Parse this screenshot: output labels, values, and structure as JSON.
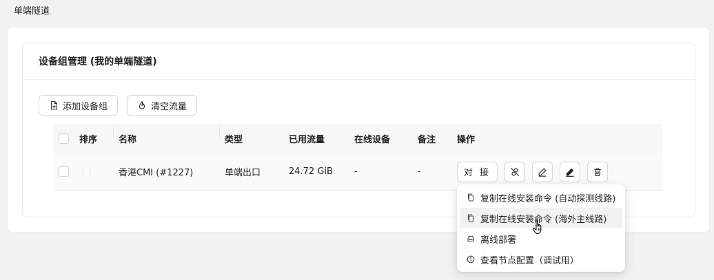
{
  "page": {
    "title": "单端隧道"
  },
  "card": {
    "title": "设备组管理 (我的单端隧道)"
  },
  "toolbar": {
    "add_label": "添加设备组",
    "clear_label": "清空流量"
  },
  "table": {
    "headers": {
      "sort": "排序",
      "name": "名称",
      "type": "类型",
      "used": "已用流量",
      "online": "在线设备",
      "note": "备注",
      "ops": "操作"
    },
    "rows": [
      {
        "name": "香港CMI (#1227)",
        "type": "单端出口",
        "used": "24.72 GiB",
        "online": "-",
        "note": "-",
        "connect_label": "对 接"
      }
    ]
  },
  "menu": {
    "items": [
      {
        "label": "复制在线安装命令 (自动探测线路)"
      },
      {
        "label": "复制在线安装命令 (海外主线路)"
      },
      {
        "label": "离线部署"
      },
      {
        "label": "查看节点配置（调试用）"
      }
    ]
  },
  "icons": {
    "add": "file-plus-icon",
    "clear": "flame-icon",
    "unlink": "unlink-icon",
    "edit": "pencil-icon",
    "edit_filled": "pencil-filled-icon",
    "delete": "trash-icon",
    "copy": "copy-icon",
    "offline": "archive-icon",
    "info": "info-icon",
    "drag": "drag-handle-icon"
  }
}
